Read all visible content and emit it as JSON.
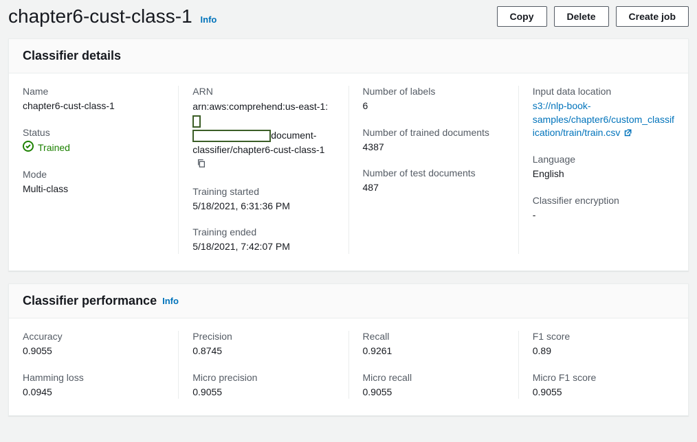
{
  "page_title": "chapter6-cust-class-1",
  "info_label": "Info",
  "actions": {
    "copy": "Copy",
    "delete": "Delete",
    "create_job": "Create job"
  },
  "panels": {
    "details": {
      "title": "Classifier details",
      "name_label": "Name",
      "name_value": "chapter6-cust-class-1",
      "status_label": "Status",
      "status_value": "Trained",
      "mode_label": "Mode",
      "mode_value": "Multi-class",
      "arn_label": "ARN",
      "arn_part1": "arn:aws:comprehend:us-east-1:",
      "arn_part2": "document-classifier/chapter6-cust-class-1",
      "training_started_label": "Training started",
      "training_started_value": "5/18/2021, 6:31:36 PM",
      "training_ended_label": "Training ended",
      "training_ended_value": "5/18/2021, 7:42:07 PM",
      "num_labels_label": "Number of labels",
      "num_labels_value": "6",
      "num_trained_label": "Number of trained documents",
      "num_trained_value": "4387",
      "num_test_label": "Number of test documents",
      "num_test_value": "487",
      "input_loc_label": "Input data location",
      "input_loc_value": "s3://nlp-book-samples/chapter6/custom_classification/train/train.csv",
      "language_label": "Language",
      "language_value": "English",
      "encryption_label": "Classifier encryption",
      "encryption_value": "-"
    },
    "performance": {
      "title": "Classifier performance",
      "accuracy_label": "Accuracy",
      "accuracy_value": "0.9055",
      "hamming_label": "Hamming loss",
      "hamming_value": "0.0945",
      "precision_label": "Precision",
      "precision_value": "0.8745",
      "micro_precision_label": "Micro precision",
      "micro_precision_value": "0.9055",
      "recall_label": "Recall",
      "recall_value": "0.9261",
      "micro_recall_label": "Micro recall",
      "micro_recall_value": "0.9055",
      "f1_label": "F1 score",
      "f1_value": "0.89",
      "micro_f1_label": "Micro F1 score",
      "micro_f1_value": "0.9055"
    }
  }
}
